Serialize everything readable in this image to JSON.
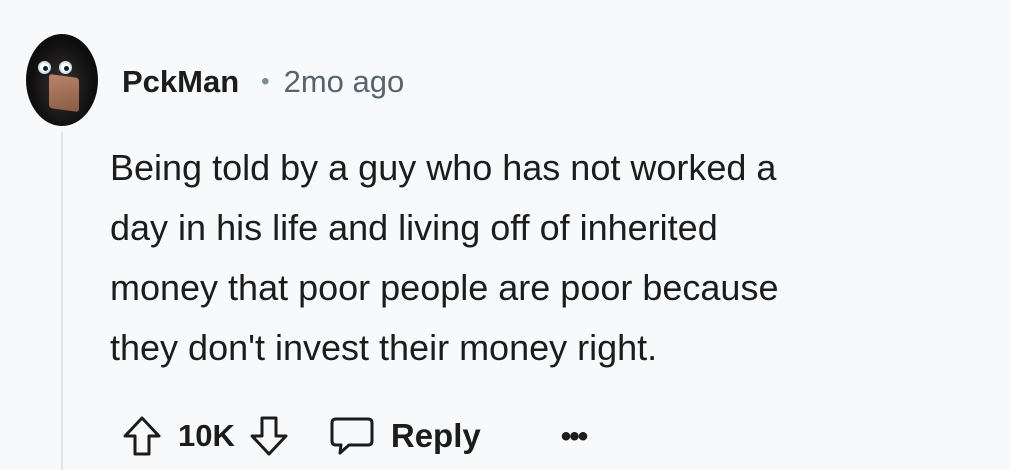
{
  "comment": {
    "username": "PckMan",
    "separator": "•",
    "timestamp": "2mo ago",
    "lines": [
      "Being told by a guy who has not worked a",
      "day in his life and living off of inherited",
      "money that poor people are poor because",
      "they don't invest their money right."
    ],
    "score": "10K",
    "reply_label": "Reply",
    "more_label": "•••"
  },
  "icons": {
    "upvote": "upvote-arrow-icon",
    "downvote": "downvote-arrow-icon",
    "reply": "speech-bubble-icon",
    "more": "ellipsis-icon"
  }
}
